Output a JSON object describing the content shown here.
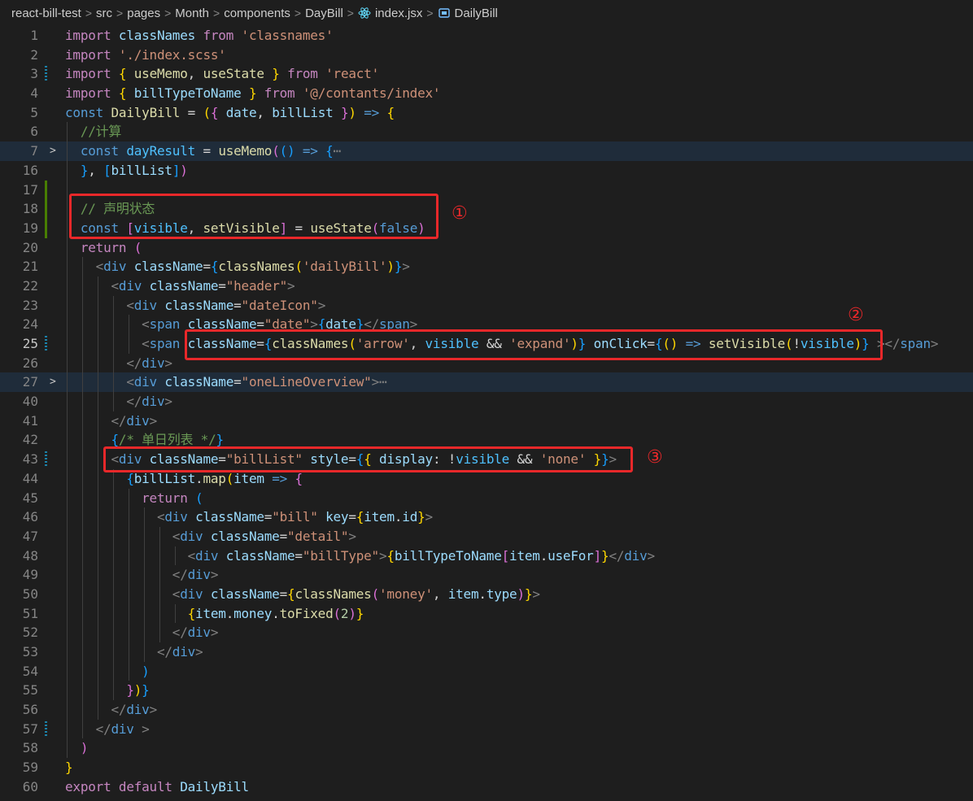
{
  "breadcrumb": {
    "items": [
      "react-bill-test",
      "src",
      "pages",
      "Month",
      "components",
      "DayBill"
    ],
    "file": "index.jsx",
    "symbol": "DailyBill"
  },
  "lines": {
    "n1": "1",
    "n2": "2",
    "n3": "3",
    "n4": "4",
    "n5": "5",
    "n6": "6",
    "n7": "7",
    "n16": "16",
    "n17": "17",
    "n18": "18",
    "n19": "19",
    "n20": "20",
    "n21": "21",
    "n22": "22",
    "n23": "23",
    "n24": "24",
    "n25": "25",
    "n26": "26",
    "n27": "27",
    "n40": "40",
    "n41": "41",
    "n42": "42",
    "n43": "43",
    "n44": "44",
    "n45": "45",
    "n46": "46",
    "n47": "47",
    "n48": "48",
    "n49": "49",
    "n50": "50",
    "n51": "51",
    "n52": "52",
    "n53": "53",
    "n54": "54",
    "n55": "55",
    "n56": "56",
    "n57": "57",
    "n58": "58",
    "n59": "59",
    "n60": "60"
  },
  "annotations": [
    "①",
    "②",
    "③"
  ],
  "tokens": {
    "import": "import",
    "from": "from",
    "const": "const",
    "return": "return",
    "export": "export",
    "default": "default",
    "classNames": "classNames",
    "classnames_str": "'classnames'",
    "scss_str": "'./index.scss'",
    "useMemo": "useMemo",
    "useState": "useState",
    "react_str": "'react'",
    "billTypeToName": "billTypeToName",
    "contants_str": "'@/contants/index'",
    "DailyBill": "DailyBill",
    "date": "date",
    "billList": "billList",
    "comment_calc": "//计算",
    "dayResult": "dayResult",
    "ellipsis": "⋯",
    "comment_state": "// 声明状态",
    "visible": "visible",
    "setVisible": "setVisible",
    "false": "false",
    "div": "div",
    "span": "span",
    "className": "className",
    "dailyBill_str": "'dailyBill'",
    "header_str": "\"header\"",
    "dateIcon_str": "\"dateIcon\"",
    "date_str": "\"date\"",
    "arrow_str": "'arrow'",
    "expand_str": "'expand'",
    "onClick": "onClick",
    "oneLineOverview_str": "\"oneLineOverview\"",
    "comment_list": "/* 单日列表 */",
    "billList_str": "\"billList\"",
    "style": "style",
    "display": "display",
    "none_str": "'none'",
    "map": "map",
    "item": "item",
    "bill_str": "\"bill\"",
    "key": "key",
    "id": "id",
    "detail_str": "\"detail\"",
    "billType_str": "\"billType\"",
    "useFor": "useFor",
    "money_str": "'money'",
    "type": "type",
    "money": "money",
    "toFixed": "toFixed",
    "two": "2"
  }
}
